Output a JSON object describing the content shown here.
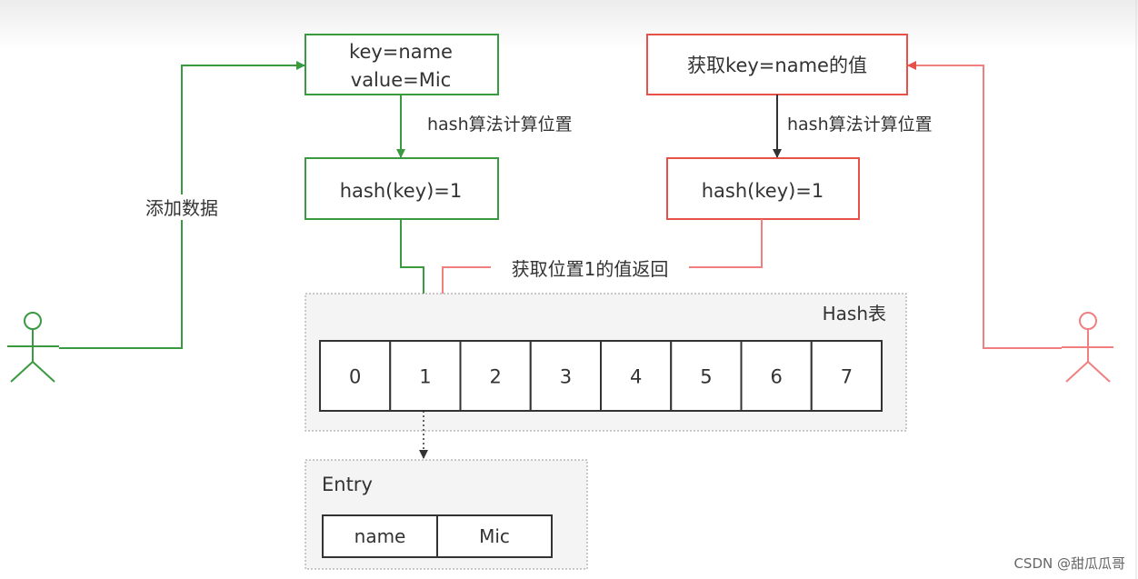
{
  "colors": {
    "green": "#3a9a40",
    "red": "#e8504a",
    "red_light": "#f08080",
    "gray_fill": "#f4f4f4",
    "dark": "#333333"
  },
  "add_flow": {
    "actor_label": "添加数据",
    "entry_box": [
      "key=name",
      "value=Mic"
    ],
    "hash_label": "hash算法计算位置",
    "hash_box": "hash(key)=1"
  },
  "get_flow": {
    "request_box": "获取key=name的值",
    "hash_label": "hash算法计算位置",
    "hash_box": "hash(key)=1",
    "return_label": "获取位置1的值返回"
  },
  "hash_table": {
    "title": "Hash表",
    "cells": [
      "0",
      "1",
      "2",
      "3",
      "4",
      "5",
      "6",
      "7"
    ]
  },
  "entry": {
    "title": "Entry",
    "key": "name",
    "value": "Mic"
  },
  "watermark": "CSDN @甜瓜瓜哥"
}
